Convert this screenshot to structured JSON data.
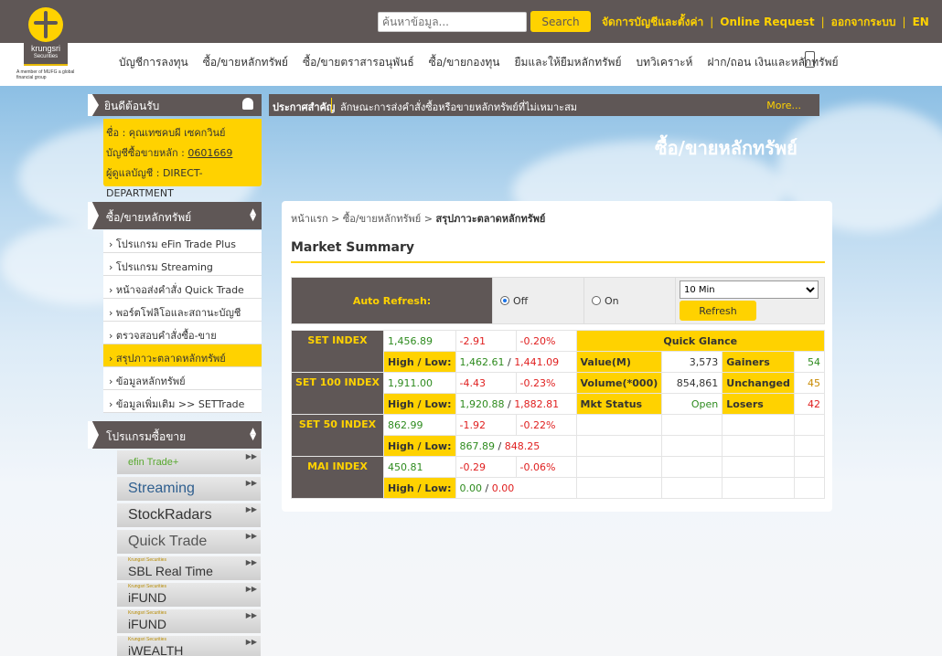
{
  "brand": {
    "name": "krungsri",
    "sub": "Securities",
    "member": "A member of MUFG a global financial group"
  },
  "header": {
    "search_placeholder": "ค้นหาข้อมูล...",
    "search_label": "Search",
    "links": [
      "จัดการบัญชีและตั้งค่า",
      "Online Request",
      "ออกจากระบบ",
      "EN"
    ]
  },
  "nav": {
    "items": [
      "บัญชีการลงทุน",
      "ซื้อ/ขายหลักทรัพย์",
      "ซื้อ/ขายตราสารอนุพันธ์",
      "ซื้อ/ขายกองทุน",
      "ยืมและให้ยืมหลักทรัพย์",
      "บทวิเคราะห์",
      "ฝาก/ถอน เงินและหลักทรัพย์"
    ]
  },
  "welcome": {
    "title": "ยินดีต้อนรับ",
    "name_label": "ชื่อ : คุณเทซคบผี เซคกวินย์",
    "acct_label": "บัญชีซื้อขายหลัก : ",
    "acct": "0601669",
    "manager": "ผู้ดูแลบัญชี : DIRECT-DEPARTMENT"
  },
  "announce": {
    "label": "ประกาศสำคัญ",
    "text": "ลักษณะการส่งคำสั่งซื้อหรือขายหลักทรัพย์ที่ไม่เหมาะสม",
    "more": "More..."
  },
  "page_title": "ซื้อ/ขายหลักทรัพย์",
  "menu": {
    "title": "ซื้อ/ขายหลักทรัพย์",
    "items": [
      "› โปรแกรม eFin Trade Plus",
      "› โปรแกรม Streaming",
      "› หน้าจอส่งคำสั่ง Quick Trade",
      "› พอร์ตโฟลิโอและสถานะบัญชี",
      "› ตรวจสอบคำสั่งซื้อ-ขาย",
      "› สรุปภาวะตลาดหลักทรัพย์",
      "› ข้อมูลหลักทรัพย์",
      "› ข้อมูลเพิ่มเติม >> SETTrade"
    ],
    "active": 5
  },
  "programs": {
    "title": "โปรแกรมซื้อขาย",
    "items": [
      "efin Trade+",
      "Streaming",
      "StockRadars",
      "Quick Trade",
      "SBL Real Time",
      "iFUND",
      "iFUND",
      "iWEALTH"
    ],
    "small": [
      "",
      "",
      "",
      "",
      "Krungsri Securities",
      "Krungsri Securities",
      "Krungsri Securities",
      "Krungsri Securities"
    ]
  },
  "breadcrumb": {
    "home": "หน้าแรก",
    "parent": "ซื้อ/ขายหลักทรัพย์",
    "current": "สรุปภาวะตลาดหลักทรัพย์",
    "sep": " > "
  },
  "market": {
    "title": "Market Summary",
    "auto_refresh": "Auto Refresh:",
    "off": "Off",
    "on": "On",
    "interval": "10 Min",
    "refresh": "Refresh",
    "hl_label": "High / Low:",
    "slash": " / ",
    "indices": [
      {
        "name": "SET INDEX",
        "value": "1,456.89",
        "chg": "-2.91",
        "pct": "-0.20%",
        "high": "1,462.61",
        "low": "1,441.09"
      },
      {
        "name": "SET 100 INDEX",
        "value": "1,911.00",
        "chg": "-4.43",
        "pct": "-0.23%",
        "high": "1,920.88",
        "low": "1,882.81"
      },
      {
        "name": "SET 50 INDEX",
        "value": "862.99",
        "chg": "-1.92",
        "pct": "-0.22%",
        "high": "867.89",
        "low": "848.25"
      },
      {
        "name": "MAI INDEX",
        "value": "450.81",
        "chg": "-0.29",
        "pct": "-0.06%",
        "high": "0.00",
        "low": "0.00"
      }
    ],
    "qg": {
      "title": "Quick Glance",
      "value_label": "Value(M)",
      "value": "3,573",
      "volume_label": "Volume(*000)",
      "volume": "854,861",
      "status_label": "Mkt Status",
      "status": "Open",
      "gainers_label": "Gainers",
      "gainers": "54",
      "unchanged_label": "Unchanged",
      "unchanged": "45",
      "losers_label": "Losers",
      "losers": "42"
    }
  }
}
